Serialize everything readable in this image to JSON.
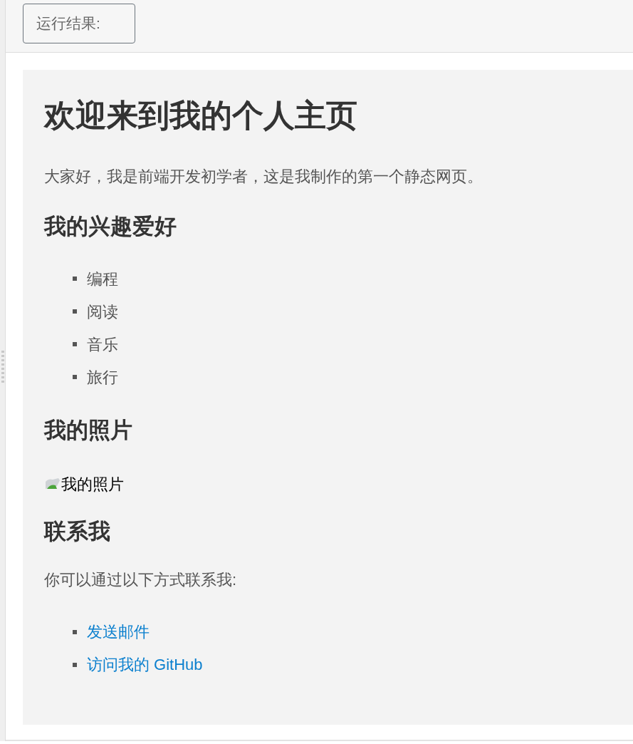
{
  "run_button": "运行结果:",
  "page": {
    "heading": "欢迎来到我的个人主页",
    "intro": "大家好，我是前端开发初学者，这是我制作的第一个静态网页。",
    "sections": [
      {
        "heading": "我的兴趣爱好",
        "items": [
          {
            "kind": "text",
            "text": "编程"
          },
          {
            "kind": "text",
            "text": "阅读"
          },
          {
            "kind": "text",
            "text": "音乐"
          },
          {
            "kind": "text",
            "text": "旅行"
          }
        ]
      },
      {
        "heading": "我的照片",
        "image_alt": "我的照片"
      },
      {
        "heading": "联系我",
        "text": "你可以通过以下方式联系我:",
        "items": [
          {
            "kind": "link",
            "text": "发送邮件"
          },
          {
            "kind": "link",
            "text": "访问我的 GitHub"
          }
        ]
      }
    ]
  }
}
